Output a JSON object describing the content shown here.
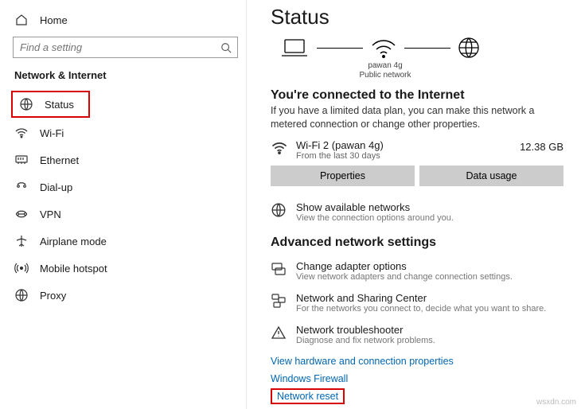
{
  "sidebar": {
    "home": "Home",
    "search_placeholder": "Find a setting",
    "header": "Network & Internet",
    "items": [
      {
        "label": "Status"
      },
      {
        "label": "Wi-Fi"
      },
      {
        "label": "Ethernet"
      },
      {
        "label": "Dial-up"
      },
      {
        "label": "VPN"
      },
      {
        "label": "Airplane mode"
      },
      {
        "label": "Mobile hotspot"
      },
      {
        "label": "Proxy"
      }
    ]
  },
  "main": {
    "title": "Status",
    "diagram": {
      "ssid": "pawan 4g",
      "net_type": "Public network"
    },
    "conn_heading": "You're connected to the Internet",
    "conn_body": "If you have a limited data plan, you can make this network a metered connection or change other properties.",
    "conn_name": "Wi-Fi 2 (pawan 4g)",
    "conn_sub": "From the last 30 days",
    "conn_data": "12.38 GB",
    "btn_properties": "Properties",
    "btn_data_usage": "Data usage",
    "show_networks": {
      "t1": "Show available networks",
      "t2": "View the connection options around you."
    },
    "adv_heading": "Advanced network settings",
    "adapter": {
      "t1": "Change adapter options",
      "t2": "View network adapters and change connection settings."
    },
    "sharing": {
      "t1": "Network and Sharing Center",
      "t2": "For the networks you connect to, decide what you want to share."
    },
    "troubleshooter": {
      "t1": "Network troubleshooter",
      "t2": "Diagnose and fix network problems."
    },
    "link_hw": "View hardware and connection properties",
    "link_firewall": "Windows Firewall",
    "link_reset": "Network reset"
  },
  "watermark": "wsxdn.com"
}
